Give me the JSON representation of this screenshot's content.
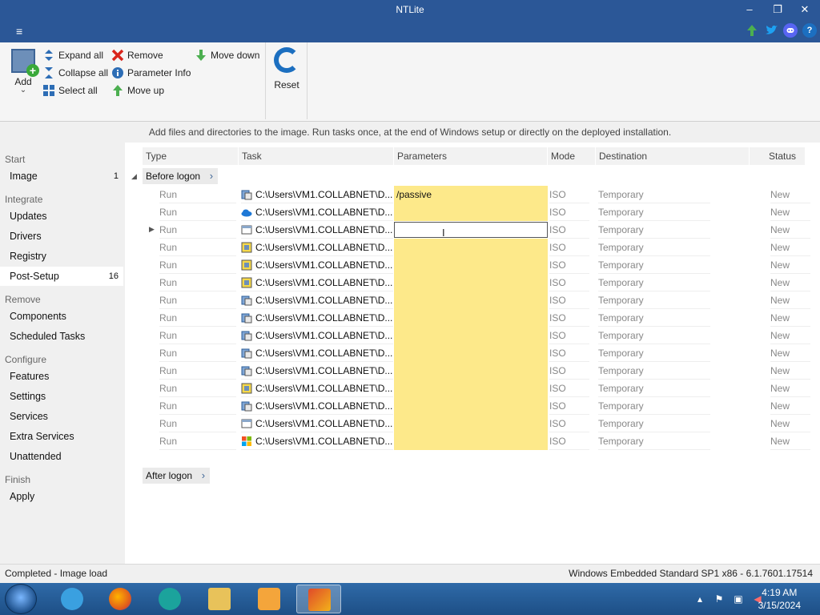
{
  "window": {
    "title": "NTLite",
    "minimize": "–",
    "restore": "❐",
    "close": "✕"
  },
  "header": {
    "menu_icon": "≡",
    "icons": [
      "green-arrow-up-icon",
      "twitter-icon",
      "discord-icon",
      "help-icon"
    ],
    "help_glyph": "?"
  },
  "ribbon": {
    "add_label": "Add",
    "add_arrow": "⌄",
    "expand_all": "Expand all",
    "collapse_all": "Collapse all",
    "select_all": "Select all",
    "remove": "Remove",
    "parameter_info": "Parameter Info",
    "move_up": "Move up",
    "move_down": "Move down",
    "reset": "Reset"
  },
  "info_text": "Add files and directories to the image. Run tasks once, at the end of Windows setup or directly on the deployed installation.",
  "sidebar": {
    "start": "Start",
    "image": "Image",
    "image_count": "1",
    "integrate": "Integrate",
    "updates": "Updates",
    "drivers": "Drivers",
    "registry": "Registry",
    "post_setup": "Post-Setup",
    "post_setup_count": "16",
    "remove": "Remove",
    "components": "Components",
    "scheduled_tasks": "Scheduled Tasks",
    "configure": "Configure",
    "features": "Features",
    "settings": "Settings",
    "services": "Services",
    "extra_services": "Extra Services",
    "unattended": "Unattended",
    "finish": "Finish",
    "apply": "Apply"
  },
  "table": {
    "columns": {
      "type": "Type",
      "task": "Task",
      "parameters": "Parameters",
      "mode": "Mode",
      "destination": "Destination",
      "status": "Status"
    },
    "before_logon": "Before logon",
    "after_logon": "After logon",
    "rows": [
      {
        "type": "Run",
        "task": "C:\\Users\\VM1.COLLABNET\\D...",
        "params": "/passive",
        "mode": "ISO",
        "dest": "Temporary",
        "status": "New",
        "icon": "installer-icon"
      },
      {
        "type": "Run",
        "task": "C:\\Users\\VM1.COLLABNET\\D...",
        "params": "",
        "mode": "ISO",
        "dest": "Temporary",
        "status": "New",
        "icon": "onedrive-icon"
      },
      {
        "type": "Run",
        "task": "C:\\Users\\VM1.COLLABNET\\D...",
        "params": "",
        "mode": "ISO",
        "dest": "Temporary",
        "status": "New",
        "icon": "window-app-icon"
      },
      {
        "type": "Run",
        "task": "C:\\Users\\VM1.COLLABNET\\D...",
        "params": "",
        "mode": "ISO",
        "dest": "Temporary",
        "status": "New",
        "icon": "package-icon"
      },
      {
        "type": "Run",
        "task": "C:\\Users\\VM1.COLLABNET\\D...",
        "params": "",
        "mode": "ISO",
        "dest": "Temporary",
        "status": "New",
        "icon": "package-icon"
      },
      {
        "type": "Run",
        "task": "C:\\Users\\VM1.COLLABNET\\D...",
        "params": "",
        "mode": "ISO",
        "dest": "Temporary",
        "status": "New",
        "icon": "package-icon"
      },
      {
        "type": "Run",
        "task": "C:\\Users\\VM1.COLLABNET\\D...",
        "params": "",
        "mode": "ISO",
        "dest": "Temporary",
        "status": "New",
        "icon": "installer-icon"
      },
      {
        "type": "Run",
        "task": "C:\\Users\\VM1.COLLABNET\\D...",
        "params": "",
        "mode": "ISO",
        "dest": "Temporary",
        "status": "New",
        "icon": "installer-icon"
      },
      {
        "type": "Run",
        "task": "C:\\Users\\VM1.COLLABNET\\D...",
        "params": "",
        "mode": "ISO",
        "dest": "Temporary",
        "status": "New",
        "icon": "installer-icon"
      },
      {
        "type": "Run",
        "task": "C:\\Users\\VM1.COLLABNET\\D...",
        "params": "",
        "mode": "ISO",
        "dest": "Temporary",
        "status": "New",
        "icon": "installer-icon"
      },
      {
        "type": "Run",
        "task": "C:\\Users\\VM1.COLLABNET\\D...",
        "params": "",
        "mode": "ISO",
        "dest": "Temporary",
        "status": "New",
        "icon": "installer-icon"
      },
      {
        "type": "Run",
        "task": "C:\\Users\\VM1.COLLABNET\\D...",
        "params": "",
        "mode": "ISO",
        "dest": "Temporary",
        "status": "New",
        "icon": "package-icon"
      },
      {
        "type": "Run",
        "task": "C:\\Users\\VM1.COLLABNET\\D...",
        "params": "",
        "mode": "ISO",
        "dest": "Temporary",
        "status": "New",
        "icon": "installer-icon"
      },
      {
        "type": "Run",
        "task": "C:\\Users\\VM1.COLLABNET\\D...",
        "params": "",
        "mode": "ISO",
        "dest": "Temporary",
        "status": "New",
        "icon": "window-app-icon"
      },
      {
        "type": "Run",
        "task": "C:\\Users\\VM1.COLLABNET\\D...",
        "params": "",
        "mode": "ISO",
        "dest": "Temporary",
        "status": "New",
        "icon": "windows-logo-icon"
      }
    ]
  },
  "statusbar": {
    "left": "Completed - Image load",
    "right": "Windows Embedded Standard SP1 x86 - 6.1.7601.17514"
  },
  "taskbar": {
    "apps": [
      "internet-explorer-icon",
      "firefox-icon",
      "app-icon",
      "file-explorer-icon",
      "media-player-icon",
      "ntlite-icon"
    ],
    "time": "4:19 AM",
    "date": "3/15/2024"
  },
  "colors": {
    "titlebar": "#2b5797",
    "param_highlight": "#fde98a",
    "accent": "#1c6fc0"
  }
}
